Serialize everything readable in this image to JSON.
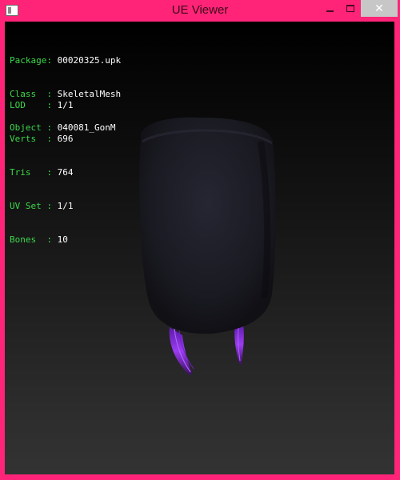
{
  "window": {
    "title": "UE Viewer",
    "accent": "#ff2477",
    "icons": [
      "app-icon",
      "minimize-icon",
      "maximize-icon",
      "close-icon"
    ]
  },
  "info": {
    "package_label": "Package:",
    "package_value": "00020325.upk",
    "class_label": "Class  :",
    "class_value": "SkeletalMesh",
    "object_label": "Object :",
    "object_value": "040081_GonM",
    "lod_label": "LOD    :",
    "lod_value": "1/1",
    "verts_label": "Verts  :",
    "verts_value": "696",
    "tris_label": "Tris   :",
    "tris_value": "764",
    "uvset_label": "UV Set :",
    "uvset_value": "1/1",
    "bones_label": "Bones  :",
    "bones_value": "10"
  },
  "colors": {
    "label_green": "#3cd84a",
    "value_white": "#ffffff",
    "mesh_body": "#1d1d26",
    "mesh_tassel": "#8a2ee0"
  }
}
